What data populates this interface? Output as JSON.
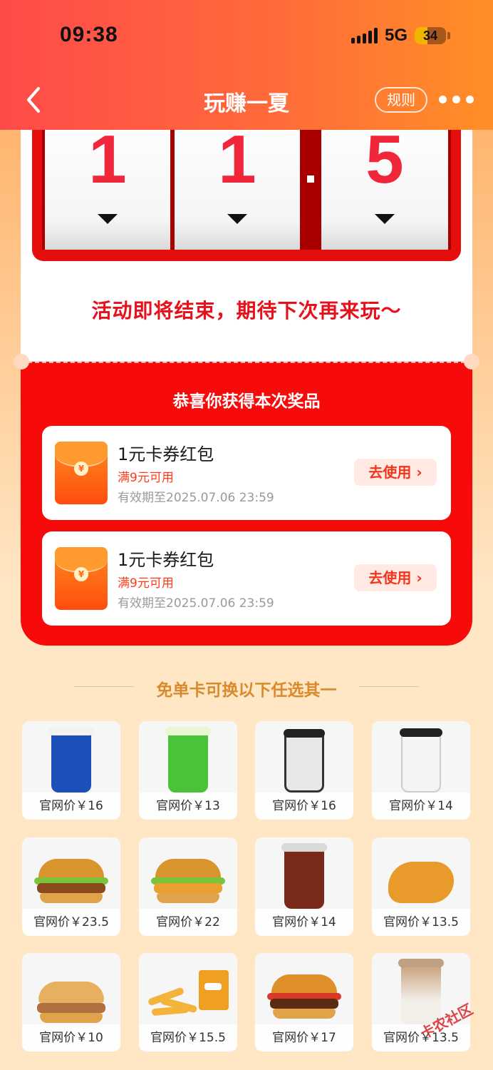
{
  "status_bar": {
    "time": "09:38",
    "network": "5G",
    "battery": "34"
  },
  "nav": {
    "title": "玩赚一夏",
    "rules_label": "规则"
  },
  "counter": {
    "digits": [
      "1",
      "1",
      "5"
    ]
  },
  "result": {
    "message": "活动即将结束，期待下次再来玩～"
  },
  "prizes": {
    "title": "恭喜你获得本次奖品",
    "items": [
      {
        "name": "1元卡券红包",
        "condition": "满9元可用",
        "expiry": "有效期至2025.07.06 23:59",
        "action": "去使用",
        "coin": "¥"
      },
      {
        "name": "1元卡券红包",
        "condition": "满9元可用",
        "expiry": "有效期至2025.07.06 23:59",
        "action": "去使用",
        "coin": "¥"
      }
    ]
  },
  "free_card": {
    "title": "免单卡可换以下任选其一",
    "products": [
      {
        "price": "官网价￥16"
      },
      {
        "price": "官网价￥13"
      },
      {
        "price": "官网价￥16"
      },
      {
        "price": "官网价￥14"
      },
      {
        "price": "官网价￥23.5"
      },
      {
        "price": "官网价￥22"
      },
      {
        "price": "官网价￥14"
      },
      {
        "price": "官网价￥13.5"
      },
      {
        "price": "官网价￥10"
      },
      {
        "price": "官网价￥15.5"
      },
      {
        "price": "官网价￥17"
      },
      {
        "price": "官网价￥13.5"
      }
    ]
  },
  "watermark": "卡农社区",
  "colors": {
    "brand_red": "#f70a0a",
    "accent_orange": "#ff8f26",
    "gold_text": "#d98a2d"
  }
}
